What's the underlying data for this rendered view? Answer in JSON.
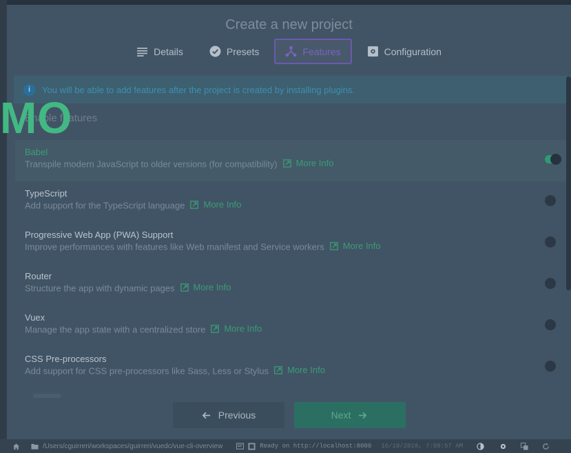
{
  "header": {
    "title": "Create a new project"
  },
  "tabs": [
    {
      "label": "Details",
      "icon": "list-icon",
      "active": false
    },
    {
      "label": "Presets",
      "icon": "check-circle-icon",
      "active": false
    },
    {
      "label": "Features",
      "icon": "nodes-icon",
      "active": true
    },
    {
      "label": "Configuration",
      "icon": "settings-box-icon",
      "active": false
    }
  ],
  "info": {
    "icon": "info-icon",
    "text": "You will be able to add features after the project is created by installing plugins."
  },
  "watermark": "MO",
  "section": {
    "title": "nable features",
    "title_prefix": "E"
  },
  "more_info_label": "More Info",
  "features": [
    {
      "name": "Babel",
      "description": "Transpile modern JavaScript to older versions (for compatibility)",
      "enabled": true
    },
    {
      "name": "TypeScript",
      "description": "Add support for the TypeScript language",
      "enabled": false
    },
    {
      "name": "Progressive Web App (PWA) Support",
      "description": "Improve performances with features like Web manifest and Service workers",
      "enabled": false
    },
    {
      "name": "Router",
      "description": "Structure the app with dynamic pages",
      "enabled": false
    },
    {
      "name": "Vuex",
      "description": "Manage the app state with a centralized store",
      "enabled": false
    },
    {
      "name": "CSS Pre-processors",
      "description": "Add support for CSS pre-processors like Sass, Less or Stylus",
      "enabled": false
    }
  ],
  "footer": {
    "previous_label": "Previous",
    "next_label": "Next"
  },
  "statusbar": {
    "path": "/Users/cguirreri/workspaces/guirreri/vuedc/vue-cli-overview",
    "ready_text": "Ready on http://localhost:8000",
    "timestamp": "16/10/2018, 7:09:57 AM"
  },
  "colors": {
    "accent": "#42b883",
    "tab_active": "#7e62c2",
    "link": "#3a9c75"
  }
}
